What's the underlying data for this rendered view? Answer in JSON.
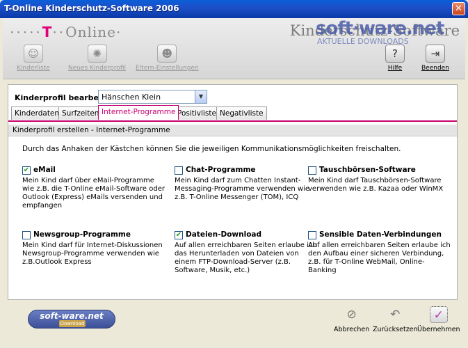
{
  "window": {
    "title": "T-Online Kinderschutz-Software 2006",
    "close_glyph": "✕"
  },
  "header": {
    "brand_dots": "·····",
    "brand_t": "T",
    "brand_dots2": "··",
    "brand_online": "Online·",
    "app_title": "Kinderschutz-Software",
    "watermark_big": "soft·ware.net",
    "watermark_small": "AKTUELLE DOWNLOADS",
    "toolbar": [
      {
        "label": "Kinderliste",
        "icon": "child-list-icon",
        "enabled": false
      },
      {
        "label": "Neues Kinderprofil",
        "icon": "new-child-icon",
        "enabled": false
      },
      {
        "label": "Eltern-Einstellungen",
        "icon": "parents-icon",
        "enabled": false
      },
      {
        "label": "Hilfe",
        "icon": "help-icon",
        "glyph": "?",
        "enabled": true
      },
      {
        "label": "Beenden",
        "icon": "exit-icon",
        "glyph": "⇥",
        "enabled": true
      }
    ]
  },
  "profile": {
    "label": "Kinderprofil bearbeiten:",
    "selected": "Hänschen Klein"
  },
  "tabs": [
    {
      "label": "Kinderdaten",
      "active": false
    },
    {
      "label": "Surfzeiten",
      "active": false
    },
    {
      "label": "Internet-Programme",
      "active": true
    },
    {
      "label": "Positivliste",
      "active": false
    },
    {
      "label": "Negativliste",
      "active": false
    }
  ],
  "section": {
    "title": "Kinderprofil erstellen - Internet-Programme",
    "intro": "Durch das Anhaken der Kästchen können Sie die jeweiligen Kommunikationsmöglichkeiten freischalten."
  },
  "options": [
    {
      "name": "eMail",
      "checked": true,
      "desc": "Mein Kind darf über eMail-Programme wie z.B. die T-Online eMail-Software oder Outlook (Express) eMails versenden und empfangen"
    },
    {
      "name": "Chat-Programme",
      "checked": false,
      "desc": "Mein Kind darf zum Chatten Instant-Messaging-Programme verwenden wie z.B. T-Online Messenger (TOM), ICQ"
    },
    {
      "name": "Tauschbörsen-Software",
      "checked": false,
      "desc": "Mein Kind darf Tauschbörsen-Software verwenden wie z.B. Kazaa oder WinMX"
    },
    {
      "name": "Newsgroup-Programme",
      "checked": false,
      "desc": "Mein Kind darf für Internet-Diskussionen Newsgroup-Programme verwenden wie z.B.Outlook Express"
    },
    {
      "name": "Dateien-Download",
      "checked": true,
      "desc": "Auf allen erreichbaren Seiten erlaube ich das Herunterladen von Dateien von einem FTP-Download-Server (z.B. Software, Musik, etc.)"
    },
    {
      "name": "Sensible Daten-Verbindungen",
      "checked": false,
      "desc": "Auf allen erreichbaren Seiten erlaube ich den Aufbau einer sicheren Verbindung, z.B. für T-Online WebMail, Online-Banking"
    }
  ],
  "footer": {
    "logo_line1": "soft-ware.net",
    "logo_line2": "Download",
    "buttons": [
      {
        "label": "Abbrechen",
        "icon": "cancel-icon",
        "glyph": "⊘"
      },
      {
        "label": "Zurücksetzen",
        "icon": "undo-icon",
        "glyph": "↶"
      },
      {
        "label": "Übernehmen",
        "icon": "apply-icon",
        "glyph": "✓"
      }
    ]
  },
  "colors": {
    "accent": "#c8006e",
    "titlebar": "#0a4fd0",
    "check": "#21a121"
  }
}
